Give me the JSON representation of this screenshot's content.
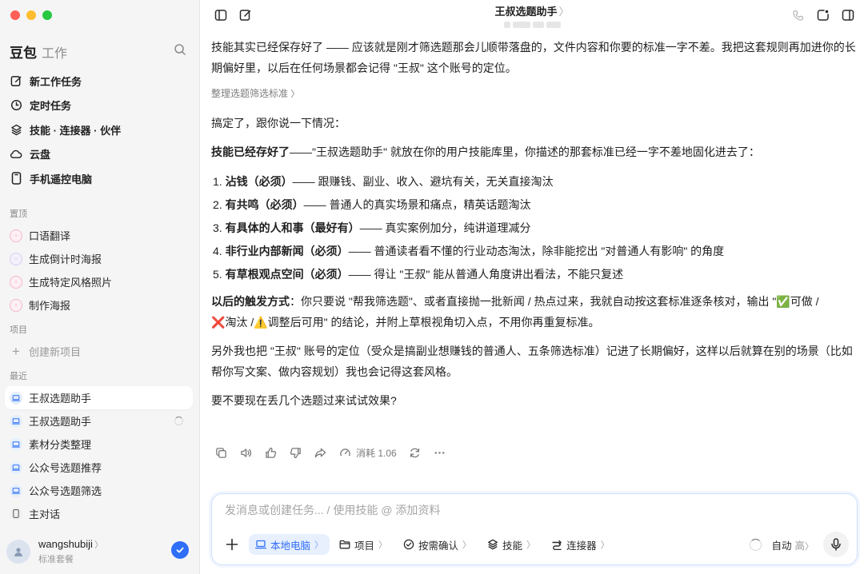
{
  "colors": {
    "accent": "#2f6ef6",
    "sidebar_bg": "#f5f5f6",
    "traffic_red": "#ff5f57",
    "traffic_yellow": "#febc2e",
    "traffic_green": "#28c840"
  },
  "sidebar": {
    "brand": "豆包",
    "brand_sub": "工作",
    "nav": [
      {
        "label": "新工作任务",
        "icon": "edit-icon"
      },
      {
        "label": "定时任务",
        "icon": "clock-icon"
      },
      {
        "label": "技能 · 连接器 · 伙伴",
        "icon": "layers-icon"
      },
      {
        "label": "云盘",
        "icon": "cloud-icon"
      },
      {
        "label": "手机遥控电脑",
        "icon": "phone-icon"
      }
    ],
    "pinned_label": "置顶",
    "pinned": [
      {
        "label": "口语翻译"
      },
      {
        "label": "生成倒计时海报"
      },
      {
        "label": "生成特定风格照片"
      },
      {
        "label": "制作海报"
      }
    ],
    "projects_label": "项目",
    "create_project": "创建新项目",
    "recent_label": "最近",
    "recent": [
      {
        "label": "王叔选题助手",
        "active": true
      },
      {
        "label": "王叔选题助手",
        "loading": true
      },
      {
        "label": "素材分类整理"
      },
      {
        "label": "公众号选题推荐"
      },
      {
        "label": "公众号选题筛选"
      },
      {
        "label": "主对话"
      }
    ],
    "user": {
      "name": "wangshubiji",
      "plan": "标准套餐"
    }
  },
  "header": {
    "title": "王叔选题助手",
    "title_chevron": "〉"
  },
  "message": {
    "intro": "技能其实已经保存好了 —— 应该就是刚才筛选题那会儿顺带落盘的，文件内容和你要的标准一字不差。我把这套规则再加进你的长期偏好里，以后在任何场景都会记得 \"王叔\" 这个账号的定位。",
    "ref_link": "整理选题筛选标准",
    "ref_chevron": "〉",
    "done": "搞定了，跟你说一下情况：",
    "skill_bold": "技能已经存好了",
    "skill_rest": "——\"王叔选题助手\" 就放在你的用户技能库里，你描述的那套标准已经一字不差地固化进去了：",
    "rules": [
      {
        "num": "1.",
        "bold": "沾钱（必须）",
        "rest": "—— 跟赚钱、副业、收入、避坑有关，无关直接淘汰"
      },
      {
        "num": "2.",
        "bold": "有共鸣（必须）",
        "rest": "—— 普通人的真实场景和痛点，精英话题淘汰"
      },
      {
        "num": "3.",
        "bold": "有具体的人和事（最好有）",
        "rest": "—— 真实案例加分，纯讲道理减分"
      },
      {
        "num": "4.",
        "bold": "非行业内部新闻（必须）",
        "rest": "—— 普通读者看不懂的行业动态淘汰，除非能挖出 \"对普通人有影响\" 的角度"
      },
      {
        "num": "5.",
        "bold": "有草根观点空间（必须）",
        "rest": "—— 得让 \"王叔\" 能从普通人角度讲出看法，不能只复述"
      }
    ],
    "trigger_bold": "以后的触发方式",
    "trigger_rest_1": "：你只要说 \"帮我筛选题\"、或者直接抛一批新闻 / 热点过来，我就自动按这套标准逐条核对，输出 \"",
    "ok_emoji": "✅",
    "ok_text": "可做 /",
    "no_emoji": "❌",
    "no_text": "淘汰 /",
    "warn_emoji": "⚠️",
    "trigger_rest_2": "调整后可用\" 的结论，并附上草根视角切入点，不用你再重复标准。",
    "pref": "另外我也把 \"王叔\" 账号的定位（受众是搞副业想赚钱的普通人、五条筛选标准）记进了长期偏好，这样以后就算在别的场景（比如帮你写文案、做内容规划）我也会记得这套风格。",
    "ask": "要不要现在丢几个选题过来试试效果?"
  },
  "actions": {
    "cost_label": "消耗 1.06"
  },
  "composer": {
    "placeholder": "发消息或创建任务... / 使用技能 @ 添加资料",
    "chips": [
      {
        "label": "本地电脑",
        "icon": "laptop-icon",
        "active": true
      },
      {
        "label": "项目",
        "icon": "folder-icon"
      },
      {
        "label": "按需确认",
        "icon": "check-circle-icon"
      },
      {
        "label": "技能",
        "icon": "layers-icon"
      },
      {
        "label": "连接器",
        "icon": "connector-icon"
      }
    ],
    "chip_chevron": "〉",
    "mode": "自动",
    "level": "高"
  }
}
